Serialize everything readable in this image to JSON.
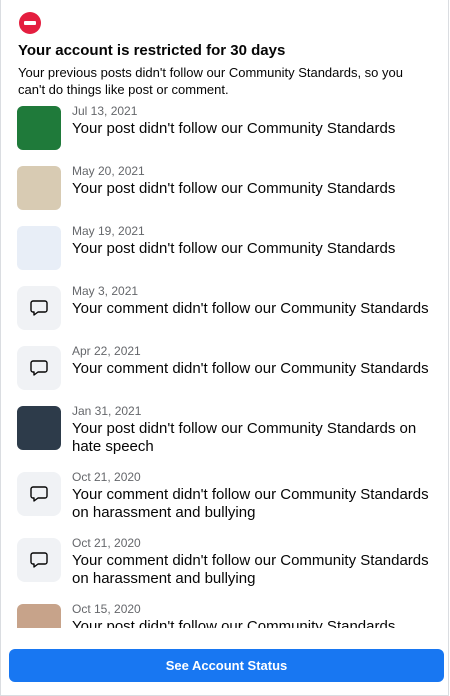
{
  "header": {
    "title": "Your account is restricted for 30 days",
    "subtitle": "Your previous posts didn't follow our Community Standards, so you can't do things like post or comment."
  },
  "items": [
    {
      "date": "Jul 13, 2021",
      "message": "Your post didn't follow our Community Standards",
      "kind": "post",
      "thumb": "img1"
    },
    {
      "date": "May 20, 2021",
      "message": "Your post didn't follow our Community Standards",
      "kind": "post",
      "thumb": "img2"
    },
    {
      "date": "May 19, 2021",
      "message": "Your post didn't follow our Community Standards",
      "kind": "post",
      "thumb": "img3"
    },
    {
      "date": "May 3, 2021",
      "message": "Your comment didn't follow our Community Standards",
      "kind": "comment",
      "thumb": "comment"
    },
    {
      "date": "Apr 22, 2021",
      "message": "Your comment didn't follow our Community Standards",
      "kind": "comment",
      "thumb": "comment"
    },
    {
      "date": "Jan 31, 2021",
      "message": "Your post didn't follow our Community Standards on hate speech",
      "kind": "post",
      "thumb": "img4"
    },
    {
      "date": "Oct 21, 2020",
      "message": "Your comment didn't follow our Community Standards on harassment and bullying",
      "kind": "comment",
      "thumb": "comment"
    },
    {
      "date": "Oct 21, 2020",
      "message": "Your comment didn't follow our Community Standards on harassment and bullying",
      "kind": "comment",
      "thumb": "comment"
    },
    {
      "date": "Oct 15, 2020",
      "message": "Your post didn't follow our Community Standards",
      "kind": "post",
      "thumb": "img5"
    }
  ],
  "footer": {
    "button_label": "See Account Status"
  },
  "colors": {
    "accent": "#1877f2",
    "restriction": "#e41e3f",
    "secondary_text": "#65676b"
  },
  "icons": {
    "restriction": "no-entry-icon",
    "comment": "speech-bubble-icon"
  }
}
